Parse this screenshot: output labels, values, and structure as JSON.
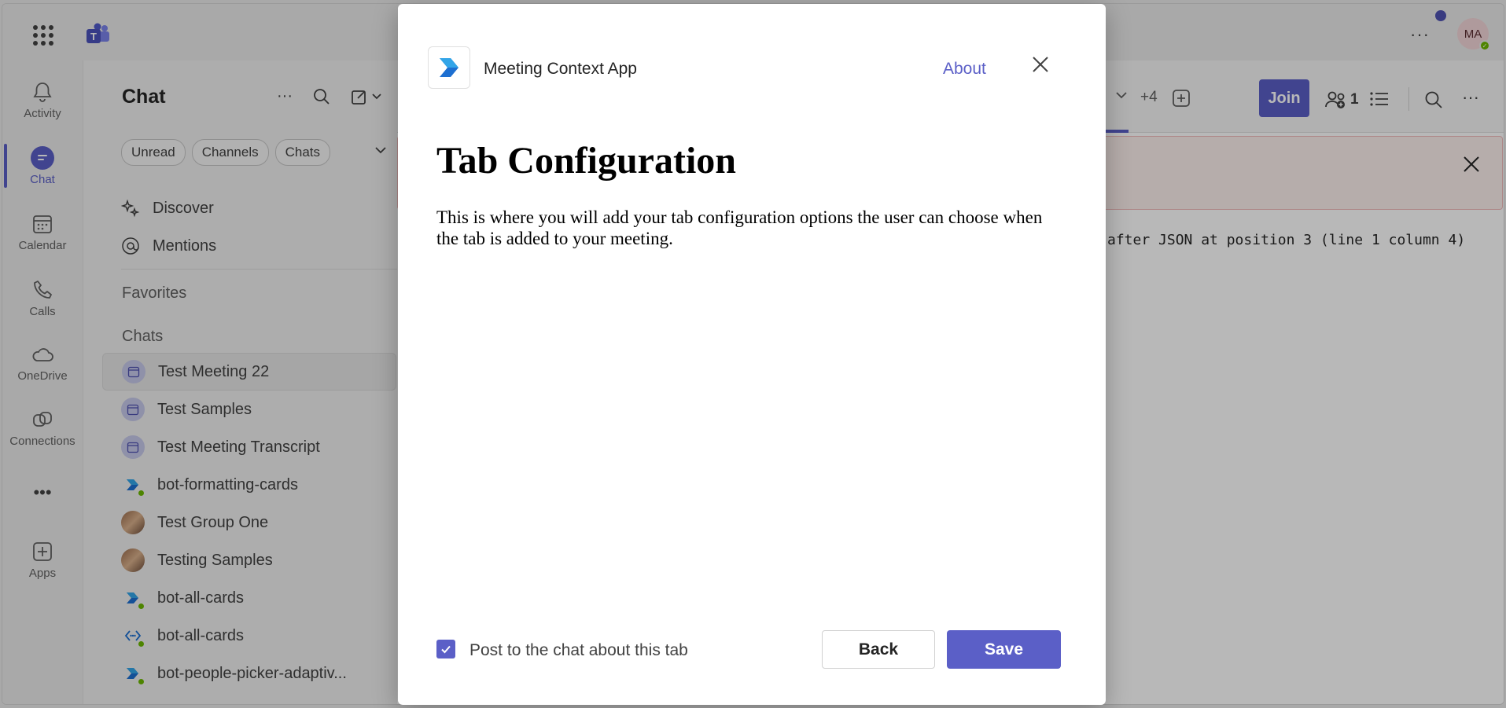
{
  "app": {
    "rail_more": "•••"
  },
  "topbar": {
    "more": "···",
    "avatar_initials": "MA"
  },
  "rail": {
    "items": [
      {
        "label": "Activity",
        "icon": "bell-icon"
      },
      {
        "label": "Chat",
        "icon": "chat-icon",
        "active": true
      },
      {
        "label": "Calendar",
        "icon": "calendar-icon"
      },
      {
        "label": "Calls",
        "icon": "phone-icon"
      },
      {
        "label": "OneDrive",
        "icon": "cloud-icon"
      },
      {
        "label": "Connections",
        "icon": "connections-icon"
      },
      {
        "label": "Apps",
        "icon": "plus-square-icon"
      }
    ]
  },
  "chatlist": {
    "title": "Chat",
    "filters": [
      "Unread",
      "Channels",
      "Chats"
    ],
    "nav": [
      {
        "label": "Discover",
        "icon": "sparkle-icon"
      },
      {
        "label": "Mentions",
        "icon": "at-icon"
      }
    ],
    "favorites_label": "Favorites",
    "chats_label": "Chats",
    "chats": [
      {
        "name": "Test Meeting 22",
        "type": "meeting",
        "selected": true
      },
      {
        "name": "Test Samples",
        "type": "meeting"
      },
      {
        "name": "Test Meeting Transcript",
        "type": "meeting"
      },
      {
        "name": "bot-formatting-cards",
        "type": "bot"
      },
      {
        "name": "Test Group One",
        "type": "group"
      },
      {
        "name": "Testing Samples",
        "type": "group"
      },
      {
        "name": "bot-all-cards",
        "type": "bot"
      },
      {
        "name": "bot-all-cards",
        "type": "bot-dev"
      },
      {
        "name": "bot-people-picker-adaptiv...",
        "type": "bot"
      }
    ]
  },
  "content": {
    "participants_extra": "+4",
    "join_label": "Join",
    "people_count": "1",
    "error_text": "after JSON at position 3 (line 1 column 4)"
  },
  "dialog": {
    "app_name": "Meeting Context App",
    "about_label": "About",
    "title": "Tab Configuration",
    "body": "This is where you will add your tab configuration options the user can choose when the tab is added to your meeting.",
    "checkbox_label": "Post to the chat about this tab",
    "checkbox_checked": true,
    "back_label": "Back",
    "save_label": "Save"
  },
  "colors": {
    "accent": "#5b5fc7",
    "presence": "#6bb700",
    "error_bg": "#fdf0ee"
  }
}
